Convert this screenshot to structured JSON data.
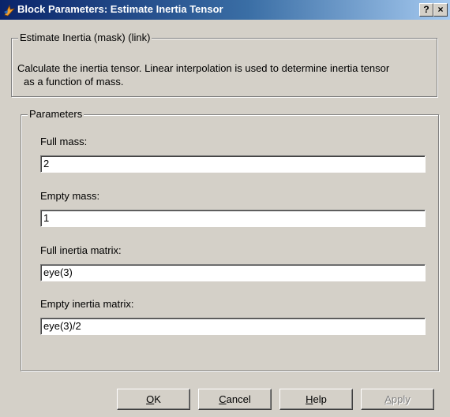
{
  "window": {
    "title": "Block Parameters: Estimate Inertia Tensor",
    "title_icon": "simulink-block-icon",
    "help_glyph": "?",
    "close_glyph": "×"
  },
  "description_group": {
    "label": "Estimate Inertia (mask) (link)",
    "line1": "Calculate the inertia tensor.  Linear interpolation is used to determine inertia tensor",
    "line2": "as a function of mass."
  },
  "parameters_group": {
    "label": "Parameters",
    "fields": [
      {
        "label": "Full mass:",
        "value": "2"
      },
      {
        "label": "Empty mass:",
        "value": "1"
      },
      {
        "label": "Full inertia matrix:",
        "value": "eye(3)"
      },
      {
        "label": "Empty inertia matrix:",
        "value": "eye(3)/2"
      }
    ]
  },
  "buttons": {
    "ok_mnemonic": "O",
    "ok_rest": "K",
    "cancel_mnemonic": "C",
    "cancel_rest": "ancel",
    "help_mnemonic": "H",
    "help_rest": "elp",
    "apply_mnemonic": "A",
    "apply_rest": "pply",
    "apply_enabled": false
  },
  "colors": {
    "titlebar_start": "#0a246a",
    "titlebar_end": "#a6caf0",
    "dialog_bg": "#d4d0c8"
  }
}
